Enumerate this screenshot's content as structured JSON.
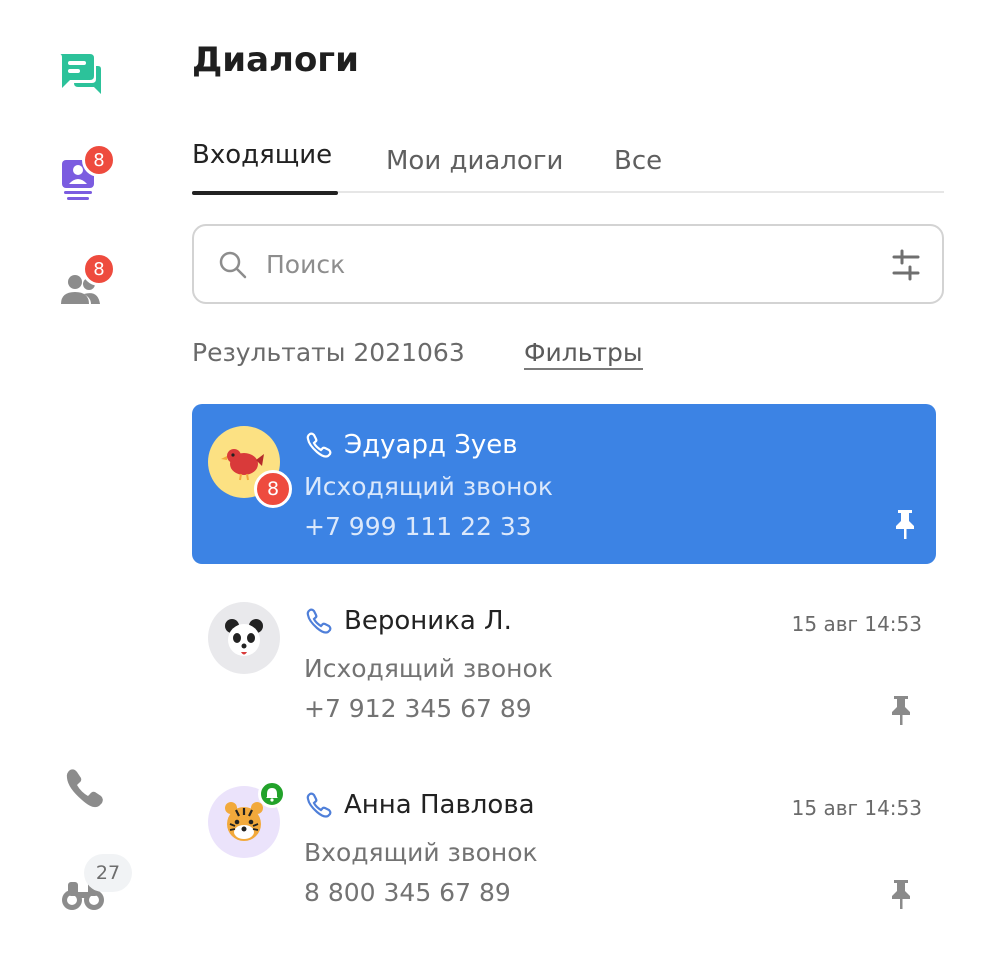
{
  "sidebar": {
    "items": [
      {
        "icon": "chat-bubbles-icon",
        "color": "#2cc29a"
      },
      {
        "icon": "inbox-queue-icon",
        "color": "#7b5ce0",
        "badge": "8"
      },
      {
        "icon": "contacts-icon",
        "color": "#8c8c8c",
        "badge": "8"
      },
      {
        "icon": "phone-icon",
        "color": "#8c8c8c"
      },
      {
        "icon": "binoculars-icon",
        "color": "#8c8c8c",
        "counter": "27"
      }
    ]
  },
  "header": {
    "title": "Диалоги"
  },
  "tabs": [
    {
      "label": "Входящие",
      "active": true
    },
    {
      "label": "Мои диалоги",
      "active": false
    },
    {
      "label": "Все",
      "active": false
    }
  ],
  "search": {
    "placeholder": "Поиск",
    "icon": "search-icon",
    "filter_icon": "sliders-icon"
  },
  "results": {
    "label": "Результаты 2021063",
    "filters_link": "Фильтры"
  },
  "dialogs": [
    {
      "name": "Эдуард Зуев",
      "call_type": "Исходящий звонок",
      "phone": "+7 999 111 22 33",
      "time": "",
      "unread": "8",
      "avatar": "bird-avatar",
      "avatar_bg": "#fce183",
      "selected": true
    },
    {
      "name": "Вероника Л.",
      "call_type": "Исходящий звонок",
      "phone": "+7 912 345 67 89",
      "time": "15 авг 14:53",
      "avatar": "panda-avatar",
      "avatar_bg": "#e9e9ec",
      "selected": false
    },
    {
      "name": "Анна Павлова",
      "call_type": "Входящий звонок",
      "phone": "8 800 345 67 89",
      "time": "15 авг 14:53",
      "avatar": "tiger-avatar",
      "avatar_bg": "#ebe3fb",
      "notification": true,
      "selected": false
    }
  ],
  "colors": {
    "accent": "#3c83e4",
    "badge": "#ee4b3e",
    "online": "#22a22a"
  }
}
